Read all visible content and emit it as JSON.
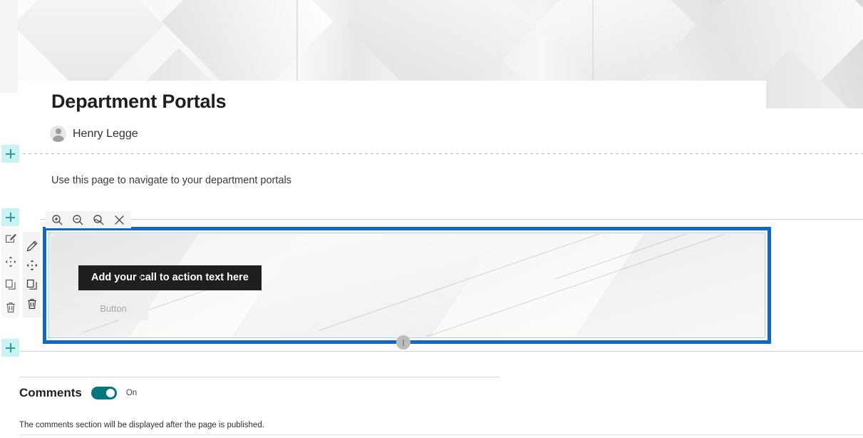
{
  "page": {
    "title": "Department Portals",
    "author": "Henry Legge",
    "body_text": "Use this page to navigate to your department portals"
  },
  "canvas": {
    "add_section_label": "+",
    "add_section_top_label": "+",
    "add_section_bottom_label": "+"
  },
  "webpart_toolbar": {
    "zoom_in": "zoom-in",
    "zoom_out": "zoom-out",
    "reset_zoom": "reset-zoom",
    "close": "close"
  },
  "webpart_rail": {
    "edit": "edit",
    "move": "move",
    "duplicate": "duplicate",
    "delete": "delete"
  },
  "section_rail": {
    "edit": "edit-section",
    "move": "move-section",
    "duplicate": "duplicate-section",
    "delete": "delete-section"
  },
  "call_to_action": {
    "heading_placeholder": "Add your call to action text here",
    "button_label": "Button"
  },
  "comments": {
    "label": "Comments",
    "state": "On",
    "note": "The comments section will be displayed after the page is published."
  },
  "colors": {
    "selection_blue": "#1068c4",
    "inner_border_teal": "#93dcd9",
    "add_button_bg": "#c9f2f2",
    "add_button_glyph": "#2e9c9c",
    "toggle_on": "#03787c",
    "cta_tooltip_bg": "#1f1f1f"
  }
}
